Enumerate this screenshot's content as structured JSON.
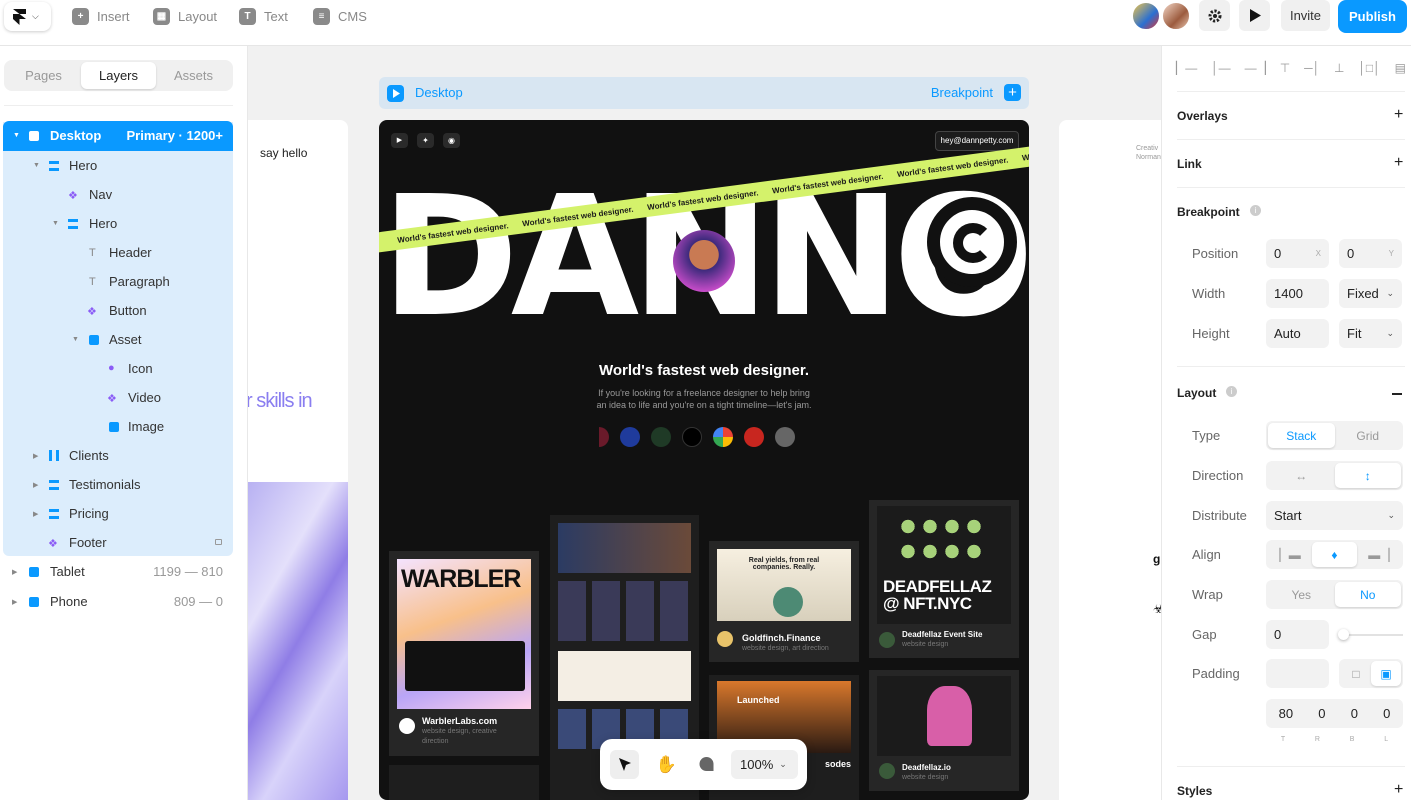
{
  "toolbar": {
    "insert": "Insert",
    "layout": "Layout",
    "text": "Text",
    "cms": "CMS",
    "invite": "Invite",
    "publish": "Publish"
  },
  "left_panel": {
    "tabs": [
      "Pages",
      "Layers",
      "Assets"
    ],
    "active_tab": "Layers",
    "layers": [
      {
        "label": "Desktop",
        "badge": "Primary · 1200+",
        "icon": "frame-icon"
      },
      {
        "label": "Hero",
        "icon": "stack-icon"
      },
      {
        "label": "Nav",
        "icon": "component-icon"
      },
      {
        "label": "Hero",
        "icon": "stack-icon"
      },
      {
        "label": "Header",
        "icon": "text-icon"
      },
      {
        "label": "Paragraph",
        "icon": "text-icon"
      },
      {
        "label": "Button",
        "icon": "component-icon"
      },
      {
        "label": "Asset",
        "icon": "frame-icon"
      },
      {
        "label": "Icon",
        "icon": "graphic-icon"
      },
      {
        "label": "Video",
        "icon": "component-icon"
      },
      {
        "label": "Image",
        "icon": "frame-icon"
      },
      {
        "label": "Clients",
        "icon": "columns-icon"
      },
      {
        "label": "Testimonials",
        "icon": "stack-icon"
      },
      {
        "label": "Pricing",
        "icon": "stack-icon"
      },
      {
        "label": "Footer",
        "icon": "component-icon"
      },
      {
        "label": "Tablet",
        "badge": "1199 — 810",
        "icon": "frame-icon"
      },
      {
        "label": "Phone",
        "badge": "809 — 0",
        "icon": "frame-icon"
      }
    ]
  },
  "canvas": {
    "frame_label": "Desktop",
    "breakpoint_label": "Breakpoint",
    "left_preview_text": "say hello",
    "left_preview_big": "r skills in",
    "right_preview_text": "Creativ Norman",
    "site": {
      "email": "hey@dannpetty.com",
      "logo": "DANNO",
      "banner": "World's fastest web designer.",
      "headline": "World's fastest web designer.",
      "paragraph_1": "If you're looking for a freelance designer to help bring",
      "paragraph_2": "an idea to life and you're on a tight timeline—let's jam.",
      "projects": [
        {
          "title": "WarblerLabs.com",
          "subtitle_1": "website design, creative",
          "subtitle_2": "direction",
          "hero": "WARBLER"
        },
        {
          "title": "Goldfinch.Finance",
          "subtitle_1": "website design, art direction",
          "hero": "Real yields, from real companies. Really."
        },
        {
          "title": "Deadfellaz Event Site",
          "subtitle_1": "website design",
          "hero": "DEADFELLAZ @ NFT.NYC"
        },
        {
          "title": "Deadfellaz.io",
          "subtitle_1": "website design"
        },
        {
          "title": "Launched",
          "subtitle_1": "sodes"
        }
      ]
    },
    "zoom": "100%"
  },
  "right_panel": {
    "overlays": "Overlays",
    "link": "Link",
    "breakpoint": "Breakpoint",
    "position_label": "Position",
    "position_x": "0",
    "position_x_unit": "X",
    "position_y": "0",
    "position_y_unit": "Y",
    "width_label": "Width",
    "width_value": "1400",
    "width_mode": "Fixed",
    "height_label": "Height",
    "height_value": "Auto",
    "height_mode": "Fit",
    "layout": "Layout",
    "type_label": "Type",
    "type_options": [
      "Stack",
      "Grid"
    ],
    "direction_label": "Direction",
    "distribute_label": "Distribute",
    "distribute_value": "Start",
    "align_label": "Align",
    "wrap_label": "Wrap",
    "wrap_options": [
      "Yes",
      "No"
    ],
    "gap_label": "Gap",
    "gap_value": "0",
    "padding_label": "Padding",
    "padding_values": [
      "80",
      "0",
      "0",
      "0"
    ],
    "padding_sides": [
      "T",
      "R",
      "B",
      "L"
    ],
    "styles": "Styles"
  }
}
